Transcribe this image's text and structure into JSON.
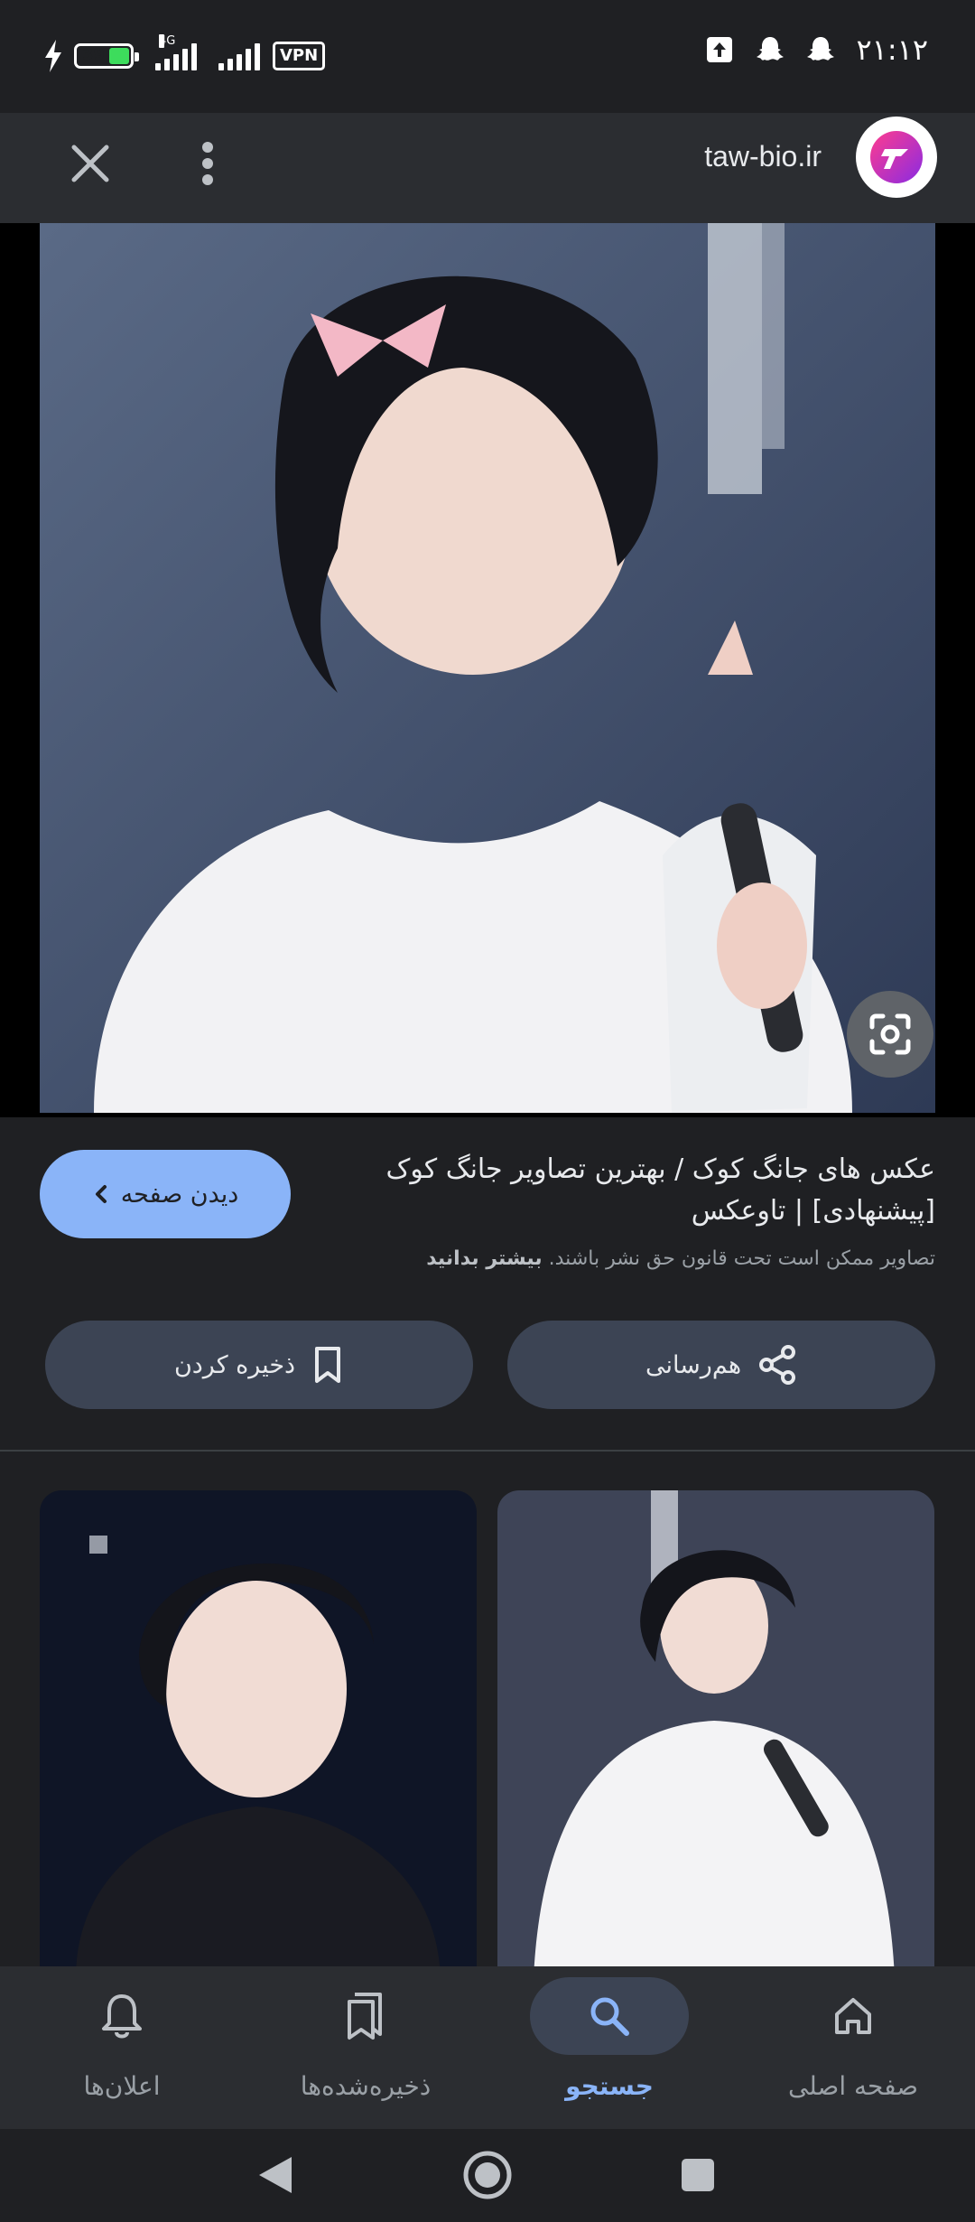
{
  "status_bar": {
    "battery_level": "39",
    "network_type": "4G",
    "vpn_label": "VPN",
    "time": "۲۱:۱۲"
  },
  "top_bar": {
    "site": "taw-bio.ir"
  },
  "result": {
    "title": "عکس های جانگ کوک / بهترین تصاویر جانگ کوک [پیشنهادی] | تاوعکس",
    "copyright_notice": "تصاویر ممکن است تحت قانون حق نشر باشند.",
    "learn_more": "بیشتر بدانید",
    "view_page": "دیدن صفحه",
    "share": "هم‌رسانی",
    "save": "ذخیره کردن"
  },
  "bottom_nav": {
    "home": "صفحه اصلی",
    "search": "جستجو",
    "saved": "ذخیره‌شده‌ها",
    "notifications": "اعلان‌ها"
  },
  "icons": {
    "close": "close-icon",
    "more": "more-vert-icon",
    "lens": "google-lens-icon",
    "share": "share-icon",
    "bookmark": "bookmark-icon",
    "home": "home-icon",
    "search": "search-icon",
    "saved": "saved-collections-icon",
    "notifications": "bell-icon"
  },
  "colors": {
    "accent": "#8ab4f8",
    "background": "#1f2023",
    "button": "#3c4454"
  }
}
